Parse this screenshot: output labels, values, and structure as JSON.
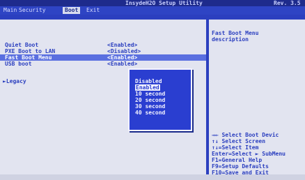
{
  "header": {
    "title": "InsydeH2O Setup Utility",
    "rev": "Rev. 3.5"
  },
  "tabs": [
    {
      "label": "Main"
    },
    {
      "label": "Security"
    },
    {
      "label": "Boot"
    },
    {
      "label": "Exit"
    }
  ],
  "active_tab": "Boot",
  "items": [
    {
      "label": "Quiet Boot",
      "value": "<Enabled>"
    },
    {
      "label": "PXE Boot to LAN",
      "value": "<Disabled>"
    },
    {
      "label": "Fast Boot Menu",
      "value": "<Enabled>"
    },
    {
      "label": "USB boot",
      "value": "<Enabled>"
    }
  ],
  "selected_item": "Fast Boot Menu",
  "legacy": "►Legacy",
  "help": {
    "title": "Fast Boot Menu",
    "description": "description"
  },
  "keys": [
    "→←    Select Boot Devic",
    "↑↓    Select Screen",
    "↑↓=Select Item",
    "Enter=Select ► SubMenu",
    "F1=General Help",
    "F9=Setup Defaults",
    "F10=Save and Exit"
  ],
  "popup": {
    "options": [
      "Disabled",
      "Enabled",
      "10 second",
      "20 second",
      "30 second",
      "40 second"
    ],
    "current": "Enabled"
  },
  "colors": {
    "frame": "#2b3fbf",
    "panel": "#e2e4f0",
    "popup": "#2a3ed0"
  }
}
